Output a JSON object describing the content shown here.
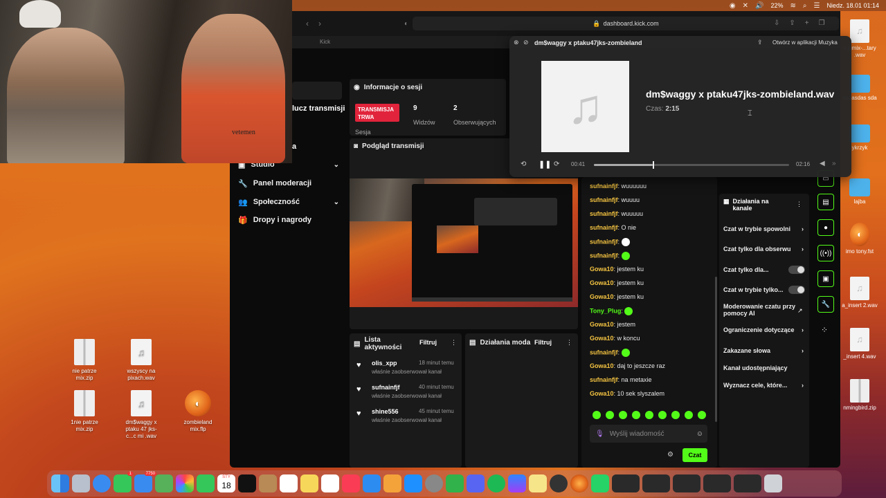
{
  "menubar": {
    "battery": "22%",
    "datetime": "Niedz. 18.01 01:14"
  },
  "browser": {
    "url": "dashboard.kick.com",
    "tab": "Kick"
  },
  "sidebar": {
    "partial_top": "lucz transmisji",
    "partial_mid": "a",
    "items": [
      {
        "label": "Studio",
        "icon": "video-icon"
      },
      {
        "label": "Panel moderacji",
        "icon": "wrench-icon"
      },
      {
        "label": "Społeczność",
        "icon": "people-icon"
      },
      {
        "label": "Dropy i nagrody",
        "icon": "gift-icon"
      }
    ]
  },
  "session": {
    "title": "Informacje o sesji",
    "badge": "TRANSMISJA TRWA",
    "viewers_value": "9",
    "viewers_label": "Widzów",
    "followers_value": "2",
    "followers_label": "Obserwujących",
    "session_label": "Sesja"
  },
  "preview": {
    "title": "Podgląd transmisji"
  },
  "activity": {
    "title": "Lista aktywności",
    "filter": "Filtruj",
    "items": [
      {
        "user": "olis_xpp",
        "time": "18 minut temu",
        "action": "właśnie zaobserwował kanał"
      },
      {
        "user": "sufnainfjf",
        "time": "40 minut temu",
        "action": "właśnie zaobserwował kanał"
      },
      {
        "user": "shine556",
        "time": "45 minut temu",
        "action": "właśnie zaobserwował kanał"
      }
    ]
  },
  "mod_actions_panel": {
    "title": "Działania moda",
    "filter": "Filtruj"
  },
  "chat": {
    "messages": [
      {
        "user": "sufnainfjf",
        "text": "wuuuuuu"
      },
      {
        "user": "sufnainfjf",
        "text": "wuuuu"
      },
      {
        "user": "sufnainfjf",
        "text": "wuuuuu"
      },
      {
        "user": "sufnainfjf",
        "text": "O nie"
      },
      {
        "user": "sufnainfjf",
        "text": ""
      },
      {
        "user": "sufnainfjf",
        "text": ""
      },
      {
        "user": "Gowa10",
        "text": "jestem ku"
      },
      {
        "user": "Gowa10",
        "text": "jestem ku"
      },
      {
        "user": "Gowa10",
        "text": "jestem ku"
      },
      {
        "user": "Tony_Plug",
        "text": ""
      },
      {
        "user": "Gowa10",
        "text": "jestem"
      },
      {
        "user": "Gowa10",
        "text": "w koncu"
      },
      {
        "user": "sufnainfjf",
        "text": ""
      },
      {
        "user": "Gowa10",
        "text": "daj to jeszcze raz"
      },
      {
        "user": "sufnainfjf",
        "text": "na metaxie"
      },
      {
        "user": "Gowa10",
        "text": "10 sek slyszalem"
      }
    ],
    "input_placeholder": "Wyślij wiadomość",
    "send_label": "Czat"
  },
  "channel_actions": {
    "title": "Działania na kanale",
    "items": [
      {
        "label": "Czat w trybie spowolni"
      },
      {
        "label": "Czat tylko dla obserwu"
      },
      {
        "label": "Czat tylko dla..."
      },
      {
        "label": "Czat w trybie tylko..."
      },
      {
        "label": "Moderowanie czatu przy pomocy AI"
      },
      {
        "label": "Ograniczenie dotyczące"
      },
      {
        "label": "Zakazane słowa"
      },
      {
        "label": "Kanał udostępniający"
      },
      {
        "label": "Wyznacz cele, które..."
      }
    ]
  },
  "music": {
    "window_title": "dm$waggy x ptaku47jks-zombieland",
    "open_in": "Otwórz w aplikacji Muzyka",
    "filename": "dm$waggy x ptaku47jks-zombieland.wav",
    "duration_label": "Czas:",
    "duration_value": "2:15",
    "elapsed": "00:41",
    "remaining": "02:16",
    "progress": 0.3
  },
  "desktop": {
    "left_icons": [
      {
        "label": "nie patrze mix.zip",
        "kind": "zip"
      },
      {
        "label": "wszyscy na pixach.wav",
        "kind": "wav"
      },
      {
        "label": "1nie patrze mix.zip",
        "kind": "zip"
      },
      {
        "label": "dm$waggy x ptaku 47 jks-c...c mi .wav",
        "kind": "wav"
      },
      {
        "label": "zombieland mix.flp",
        "kind": "flp"
      }
    ],
    "right_icons": [
      {
        "label": "x jumix-...tary .wav"
      },
      {
        "label": "asdasdas sda"
      },
      {
        "label": "ykrzyk"
      },
      {
        "label": "lajba"
      },
      {
        "label": "imo tony.fst"
      },
      {
        "label": "a_insert 2.wav"
      },
      {
        "label": "_insert 4.wav"
      },
      {
        "label": "nmingbird.zip"
      }
    ]
  },
  "dock": {
    "calendar_month": "STY",
    "calendar_day": "18",
    "mail_badge": "7750",
    "messages_badge": "1"
  },
  "webcam": {
    "shirt_text": "vetemen"
  }
}
